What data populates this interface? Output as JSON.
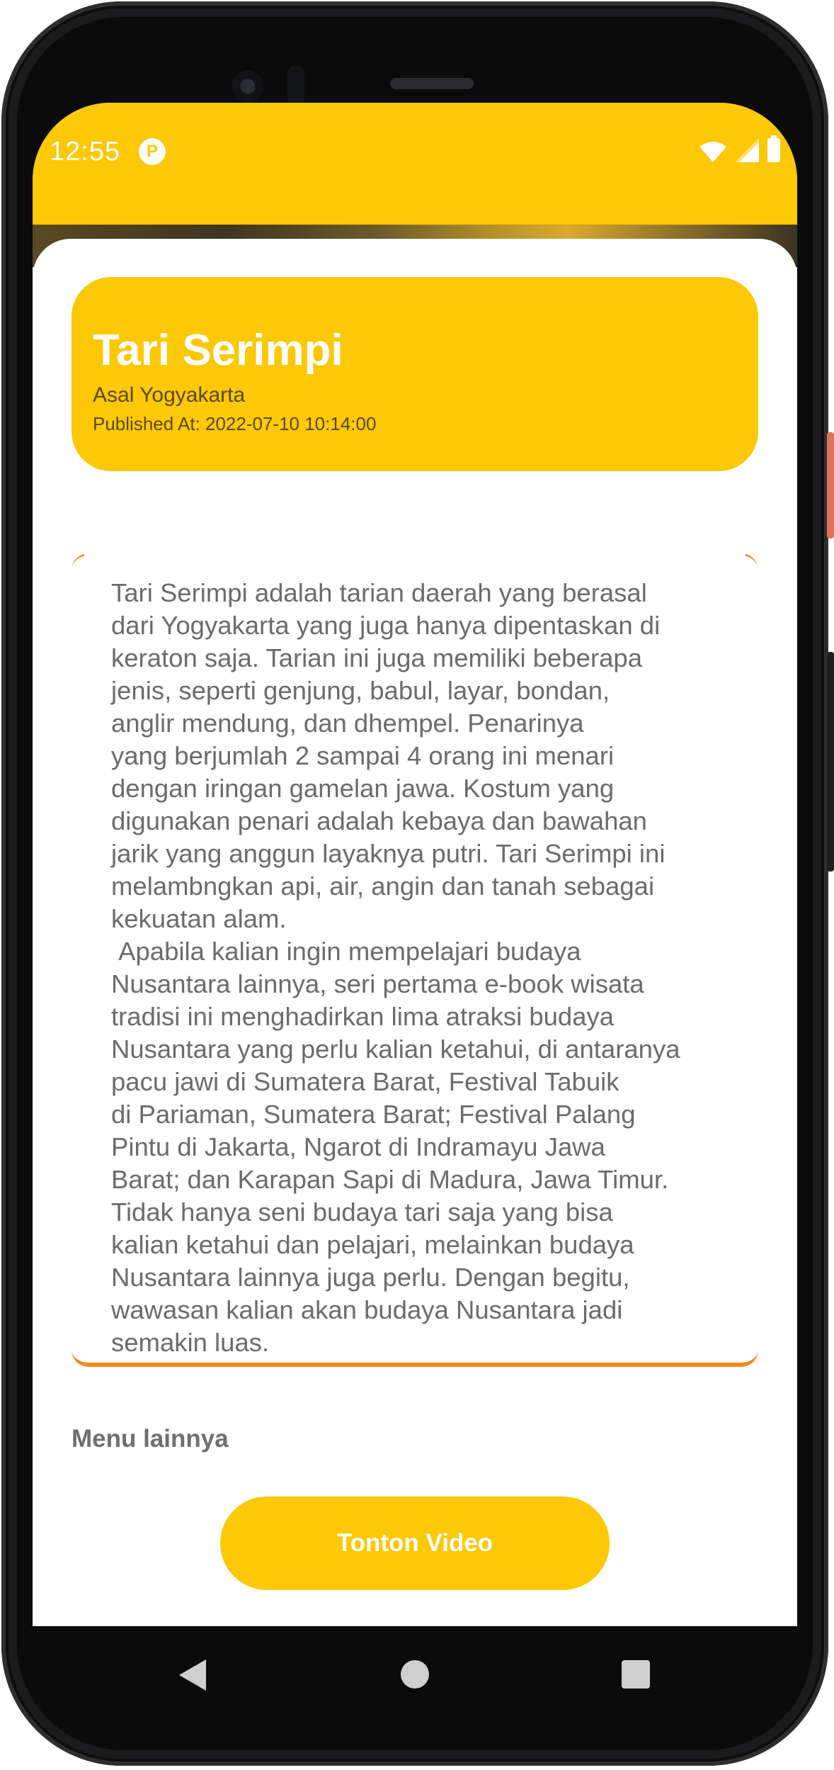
{
  "status_bar": {
    "time": "12:55",
    "app_icon_glyph": "P",
    "icons": [
      "wifi-icon",
      "signal-icon",
      "battery-icon"
    ]
  },
  "header": {
    "title": "Tari Serimpi",
    "origin": "Asal Yogyakarta",
    "published": "Published At: 2022-07-10 10:14:00"
  },
  "description": "Tari Serimpi adalah tarian daerah yang berasal\ndari Yogyakarta yang juga hanya dipentaskan di\nkeraton saja. Tarian ini juga memiliki beberapa\njenis, seperti genjung, babul, layar, bondan,\nanglir mendung, dan dhempel. Penarinya\nyang berjumlah 2 sampai 4 orang ini menari\ndengan iringan gamelan jawa. Kostum yang\ndigunakan penari adalah kebaya dan bawahan\njarik yang anggun layaknya putri. Tari Serimpi ini\nmelambngkan api, air, angin dan tanah sebagai\nkekuatan alam.\n Apabila kalian ingin mempelajari budaya\nNusantara lainnya, seri pertama e-book wisata\ntradisi ini menghadirkan lima atraksi budaya\nNusantara yang perlu kalian ketahui, di antaranya\npacu jawi di Sumatera Barat, Festival Tabuik\ndi Pariaman, Sumatera Barat; Festival Palang\nPintu di Jakarta, Ngarot di Indramayu Jawa\nBarat; dan Karapan Sapi di Madura, Jawa Timur.\nTidak hanya seni budaya tari saja yang bisa\nkalian ketahui dan pelajari, melainkan budaya\nNusantara lainnya juga perlu. Dengan begitu,\nwawasan kalian akan budaya Nusantara jadi\nsemakin luas.",
  "menu": {
    "label": "Menu lainnya",
    "video_button": "Tonton Video"
  },
  "colors": {
    "accent": "#fdc805",
    "border": "#f28a1c"
  },
  "nav": {
    "icons": [
      "back-icon",
      "home-icon",
      "recents-icon"
    ]
  }
}
